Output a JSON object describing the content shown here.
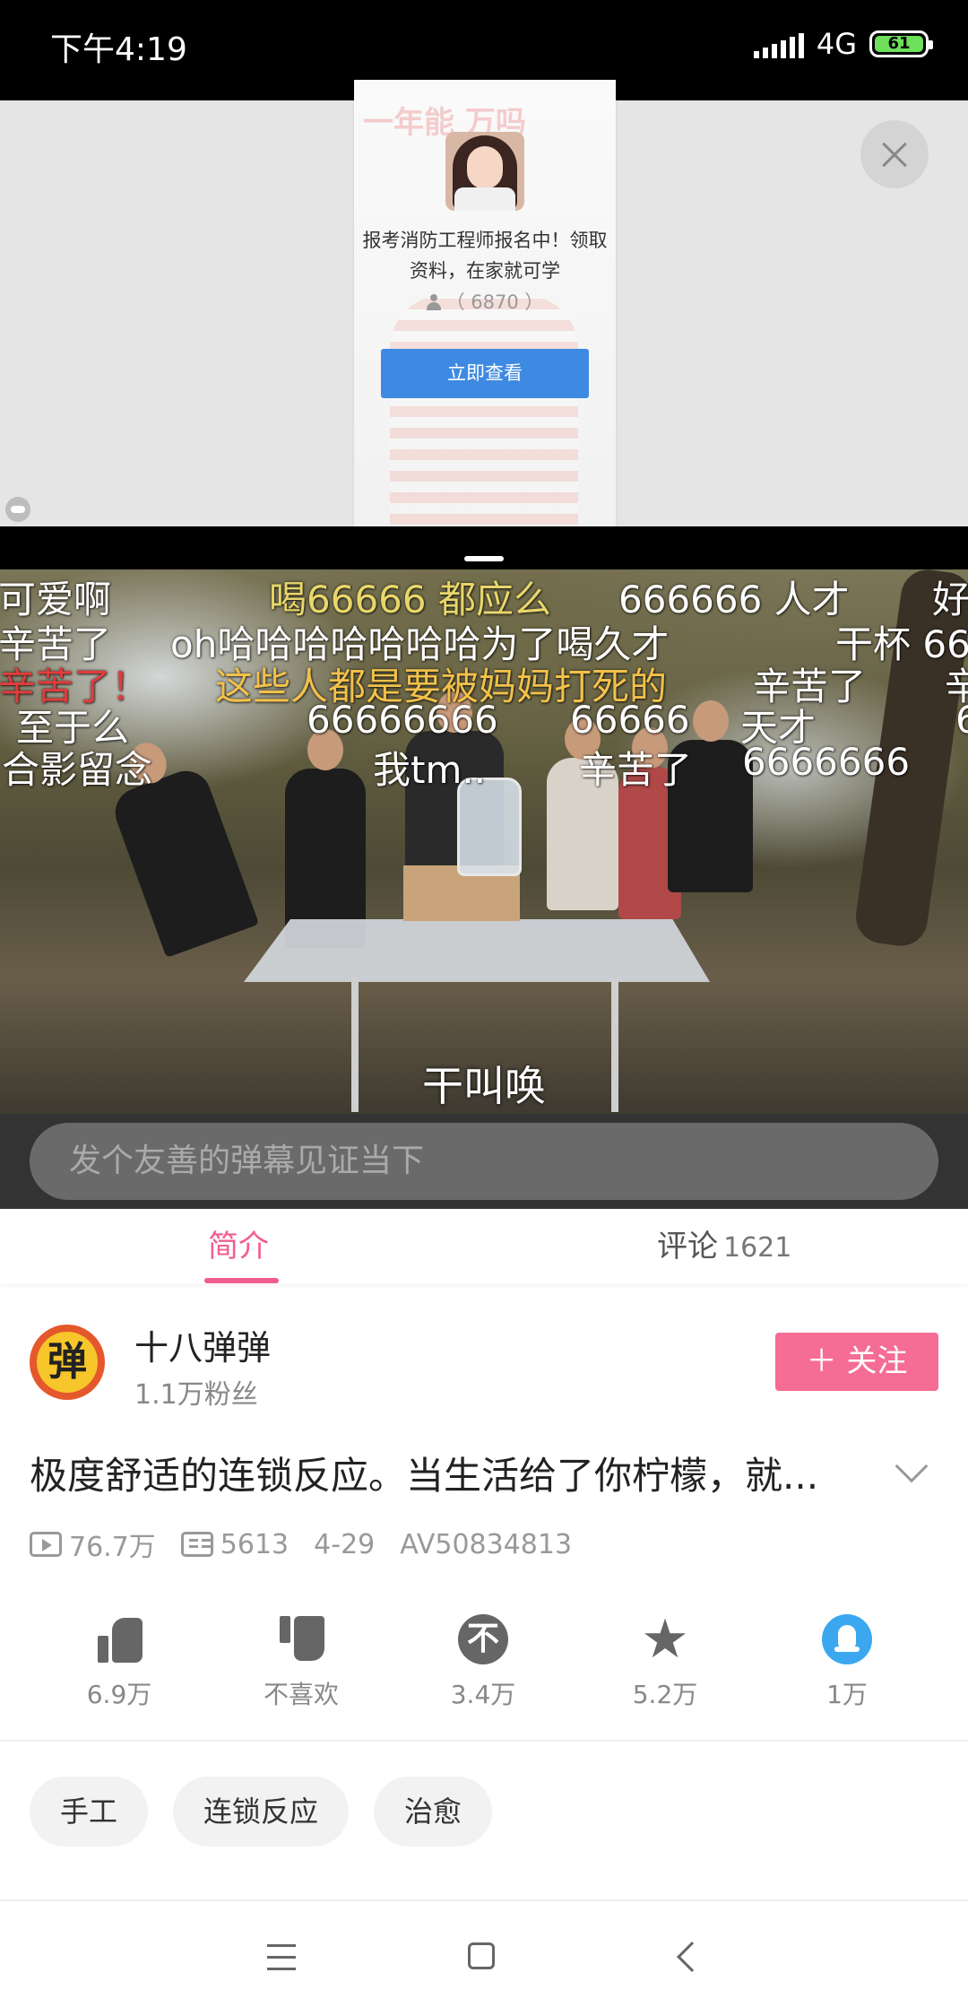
{
  "status_bar": {
    "time": "下午4:19",
    "network": "4G",
    "battery": "61"
  },
  "ad": {
    "watermark": "一年能   万吗",
    "description": "报考消防工程师报名中！领取资料，在家就可学",
    "count": "（ 6870 ）",
    "button_label": "立即查看"
  },
  "video": {
    "danmaku": [
      {
        "text": "可爱啊",
        "color": "white"
      },
      {
        "text": "喝66666 都应么",
        "color": "yellow"
      },
      {
        "text": "666666 人才",
        "color": "white"
      },
      {
        "text": "好",
        "color": "white"
      },
      {
        "text": "辛苦了",
        "color": "white"
      },
      {
        "text": "oh哈哈哈哈哈哈哈为了喝久才",
        "color": "white"
      },
      {
        "text": "干杯 66",
        "color": "white"
      },
      {
        "text": "辛苦了！",
        "color": "red"
      },
      {
        "text": "这些人都是要被妈妈打死的",
        "color": "gold"
      },
      {
        "text": "辛苦了",
        "color": "white"
      },
      {
        "text": "辛",
        "color": "white"
      },
      {
        "text": "至于么",
        "color": "white"
      },
      {
        "text": "66666666",
        "color": "white"
      },
      {
        "text": "66666",
        "color": "white"
      },
      {
        "text": "天才",
        "color": "white"
      },
      {
        "text": "6",
        "color": "white"
      },
      {
        "text": "合影留念",
        "color": "white"
      },
      {
        "text": "我tm..",
        "color": "white"
      },
      {
        "text": "辛苦了",
        "color": "white"
      },
      {
        "text": "6666666",
        "color": "white"
      }
    ],
    "subtitle": "干叫唤"
  },
  "danmaku_input": {
    "placeholder": "发个友善的弹幕见证当下"
  },
  "tabs": {
    "intro": "简介",
    "comments": "评论",
    "comments_count": "1621",
    "active": "intro"
  },
  "uploader": {
    "avatar_char": "弹",
    "name": "十八弹弹",
    "fans": "1.1万粉丝",
    "follow_label": "＋ 关注"
  },
  "video_info": {
    "title": "极度舒适的连锁反应。当生活给了你柠檬，就...",
    "views": "76.7万",
    "danmaku_count": "5613",
    "date": "4-29",
    "av": "AV50834813"
  },
  "actions": [
    {
      "icon": "thumb-up-icon",
      "label": "6.9万"
    },
    {
      "icon": "thumb-down-icon",
      "label": "不喜欢"
    },
    {
      "icon": "coin-icon",
      "label": "3.4万"
    },
    {
      "icon": "star-icon",
      "label": "5.2万"
    },
    {
      "icon": "share-icon",
      "label": "1万"
    }
  ],
  "tags": [
    "手工",
    "连锁反应",
    "治愈"
  ],
  "colors": {
    "accent": "#f25d8e",
    "follow_bg": "#f56c95",
    "ad_button": "#3e8ae2"
  }
}
